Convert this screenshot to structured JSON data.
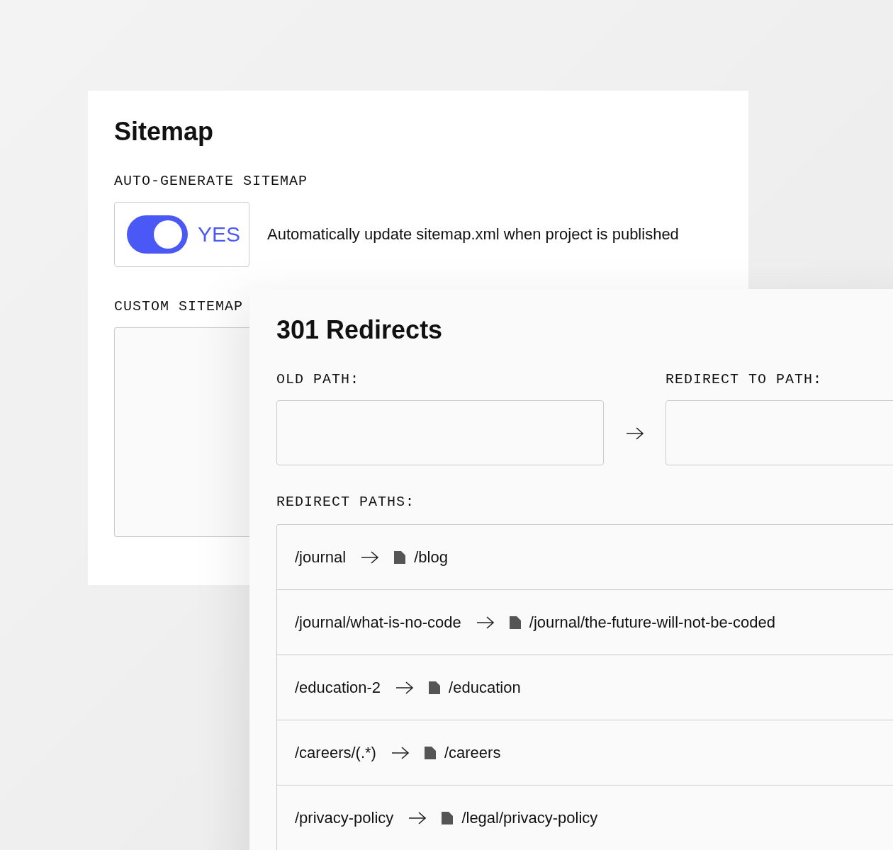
{
  "sitemap": {
    "title": "Sitemap",
    "auto_label": "AUTO-GENERATE SITEMAP",
    "toggle": {
      "on": true,
      "label": "YES"
    },
    "auto_description": "Automatically update sitemap.xml when project is published",
    "custom_label": "CUSTOM SITEMAP"
  },
  "redirects": {
    "title": "301 Redirects",
    "old_path_label": "OLD PATH:",
    "redirect_to_label": "REDIRECT TO PATH:",
    "paths_label": "REDIRECT PATHS:",
    "rows": [
      {
        "from": "/journal",
        "to": "/blog"
      },
      {
        "from": "/journal/what-is-no-code",
        "to": "/journal/the-future-will-not-be-coded"
      },
      {
        "from": "/education-2",
        "to": "/education"
      },
      {
        "from": "/careers/(.*)",
        "to": "/careers"
      },
      {
        "from": "/privacy-policy",
        "to": "/legal/privacy-policy"
      }
    ]
  }
}
